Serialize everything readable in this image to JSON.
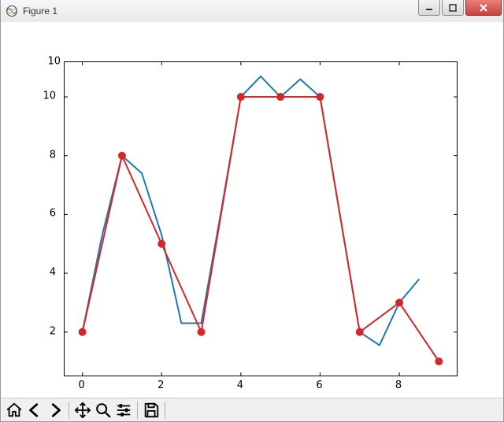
{
  "window": {
    "title": "Figure 1"
  },
  "chart_data": {
    "type": "line",
    "xlim": [
      -0.45,
      9.45
    ],
    "ylim": [
      0.52,
      11.18
    ],
    "xlabel": "",
    "ylabel": "",
    "title": "",
    "xticks": [
      0,
      2,
      4,
      6,
      8
    ],
    "yticks": [
      2,
      4,
      6,
      8,
      10
    ],
    "series": [
      {
        "name": "blue",
        "color": "#1f77b4",
        "marker": "none",
        "x": [
          0,
          0.5,
          1,
          1.5,
          2,
          2.5,
          3,
          3.5,
          4,
          4.5,
          5,
          5.5,
          6,
          6.5,
          7,
          7.5,
          8,
          8.5
        ],
        "y": [
          2.0,
          5.3,
          8.0,
          7.4,
          5.3,
          2.3,
          2.3,
          6.1,
          10.0,
          10.7,
          10.0,
          10.6,
          10.0,
          6.0,
          2.0,
          1.55,
          3.0,
          3.8
        ]
      },
      {
        "name": "red",
        "color": "#d62728",
        "marker": "circle",
        "x": [
          0,
          1,
          2,
          3,
          4,
          5,
          6,
          7,
          8,
          9
        ],
        "y": [
          2,
          8,
          5,
          2,
          10,
          10,
          10,
          2,
          3,
          1
        ]
      }
    ]
  },
  "toolbar": {
    "home": "Home",
    "back": "Back",
    "forward": "Forward",
    "pan": "Pan",
    "zoom": "Zoom",
    "configure": "Configure subplots",
    "save": "Save"
  },
  "window_controls": {
    "minimize": "Minimize",
    "maximize": "Maximize",
    "close": "Close"
  }
}
